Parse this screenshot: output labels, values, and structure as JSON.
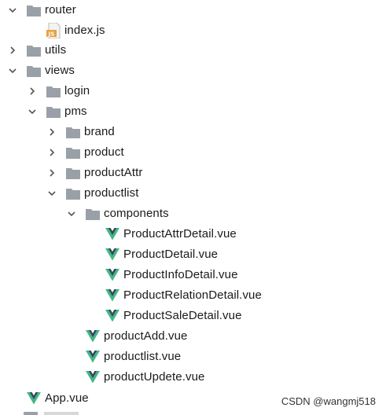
{
  "tree": {
    "items": [
      {
        "label": "router",
        "type": "folder",
        "expanded": true
      },
      {
        "label": "index.js",
        "type": "js-file"
      },
      {
        "label": "utils",
        "type": "folder",
        "expanded": false
      },
      {
        "label": "views",
        "type": "folder",
        "expanded": true
      },
      {
        "label": "login",
        "type": "folder",
        "expanded": false
      },
      {
        "label": "pms",
        "type": "folder",
        "expanded": true
      },
      {
        "label": "brand",
        "type": "folder",
        "expanded": false
      },
      {
        "label": "product",
        "type": "folder",
        "expanded": false
      },
      {
        "label": "productAttr",
        "type": "folder",
        "expanded": false
      },
      {
        "label": "productlist",
        "type": "folder",
        "expanded": true
      },
      {
        "label": "components",
        "type": "folder",
        "expanded": true
      },
      {
        "label": "ProductAttrDetail.vue",
        "type": "vue-file"
      },
      {
        "label": "ProductDetail.vue",
        "type": "vue-file"
      },
      {
        "label": "ProductInfoDetail.vue",
        "type": "vue-file"
      },
      {
        "label": "ProductRelationDetail.vue",
        "type": "vue-file"
      },
      {
        "label": "ProductSaleDetail.vue",
        "type": "vue-file"
      },
      {
        "label": "productAdd.vue",
        "type": "vue-file"
      },
      {
        "label": "productlist.vue",
        "type": "vue-file"
      },
      {
        "label": "productUpdete.vue",
        "type": "vue-file"
      },
      {
        "label": "App.vue",
        "type": "vue-file"
      }
    ]
  },
  "watermark": {
    "text": "CSDN @wangmj518"
  },
  "colors": {
    "folder": "#9aa0a8",
    "vue_green": "#41b883",
    "vue_dark": "#35495e",
    "js_badge": "#e8a33d",
    "chevron": "#555555",
    "text": "#1a1a1a"
  },
  "icons": {
    "expanded": "chevron-down-icon",
    "collapsed": "chevron-right-icon",
    "folder": "folder-icon",
    "js-file": "js-file-icon",
    "vue-file": "vue-logo-icon"
  }
}
